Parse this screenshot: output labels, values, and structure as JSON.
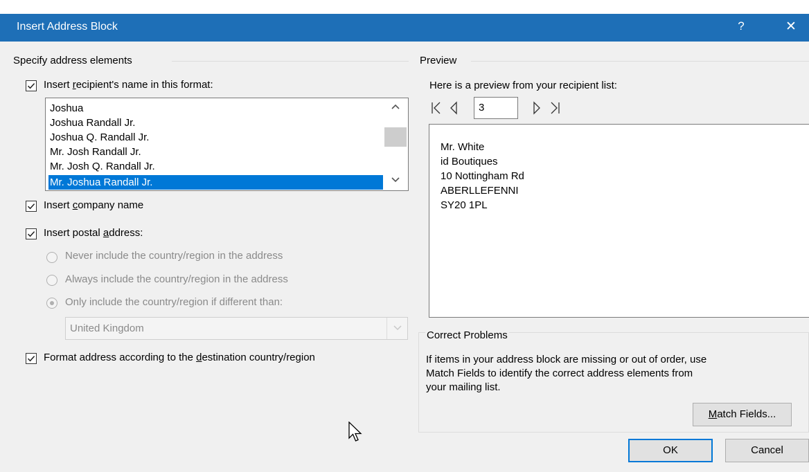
{
  "window": {
    "title": "Insert Address Block",
    "help_glyph": "?",
    "close_glyph": "✕"
  },
  "specify": {
    "group_label": "Specify address elements",
    "recipient_name": {
      "label_pre": "Insert ",
      "label_accel": "r",
      "label_post": "ecipient's name in this format:",
      "checked": true,
      "formats": [
        "Joshua",
        "Joshua Randall Jr.",
        "Joshua Q. Randall Jr.",
        "Mr. Josh Randall Jr.",
        "Mr. Josh Q. Randall Jr.",
        "Mr. Joshua Randall Jr."
      ],
      "selected_index": 5
    },
    "company": {
      "label_pre": "Insert ",
      "label_accel": "c",
      "label_post": "ompany name",
      "checked": true
    },
    "postal": {
      "label_pre": "Insert postal ",
      "label_accel": "a",
      "label_post": "ddress:",
      "checked": true,
      "options": [
        "Never include the country/region in the address",
        "Always include the country/region in the address",
        "Only include the country/region if different than:"
      ],
      "selected_option": 2,
      "country": "United Kingdom"
    },
    "format_destination": {
      "label_pre": "Format address according to the ",
      "label_accel": "d",
      "label_post": "estination country/region",
      "checked": true
    }
  },
  "preview": {
    "group_label": "Preview",
    "intro": "Here is a preview from your recipient list:",
    "record_number": "3",
    "lines": [
      "Mr. White",
      "id Boutiques",
      "10 Nottingham Rd",
      "ABERLLEFENNI",
      "SY20 1PL"
    ]
  },
  "correct": {
    "group_label": "Correct Problems",
    "description": [
      "If items in your address block are missing or out of order, use",
      "Match Fields to identify the correct address elements from",
      "your mailing list."
    ],
    "match_accel": "M",
    "match_rest": "atch Fields..."
  },
  "buttons": {
    "ok": "OK",
    "cancel": "Cancel"
  },
  "colors": {
    "titlebar": "#1e6fb7",
    "selection": "#0078d7"
  }
}
